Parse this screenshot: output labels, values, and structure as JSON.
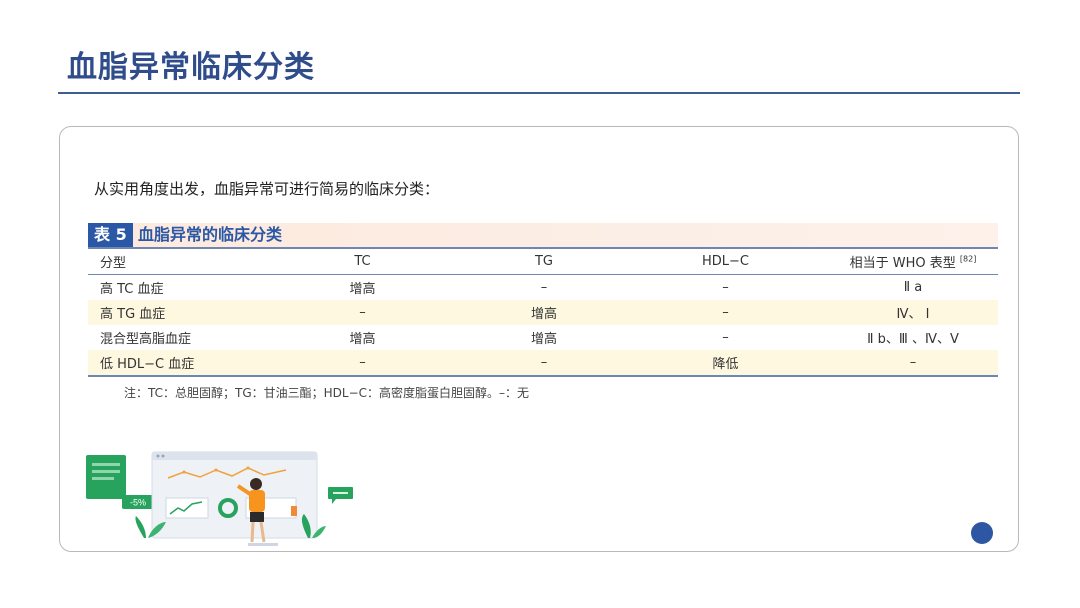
{
  "title": "血脂异常临床分类",
  "intro": "从实用角度出发，血脂异常可进行简易的临床分类：",
  "table": {
    "badge": "表 5",
    "caption": "血脂异常的临床分类",
    "headers": [
      "分型",
      "TC",
      "TG",
      "HDL−C",
      "相当于 WHO 表型"
    ],
    "header_ref": "[82]",
    "rows": [
      [
        "高 TC 血症",
        "增高",
        "–",
        "–",
        "Ⅱ a"
      ],
      [
        "高 TG 血症",
        "–",
        "增高",
        "–",
        "Ⅳ、 Ⅰ"
      ],
      [
        "混合型高脂血症",
        "增高",
        "增高",
        "–",
        "Ⅱ b、Ⅲ 、Ⅳ、Ⅴ"
      ],
      [
        "低 HDL−C 血症",
        "–",
        "–",
        "降低",
        "–"
      ]
    ],
    "note": "注：TC：总胆固醇；TG：甘油三酯；HDL−C：高密度脂蛋白胆固醇。–：无"
  },
  "illustration": {
    "percent_label": "-5%"
  },
  "colors": {
    "title": "#2f4d8a",
    "accent": "#2b58a6",
    "row_alt": "#fff8e1"
  }
}
